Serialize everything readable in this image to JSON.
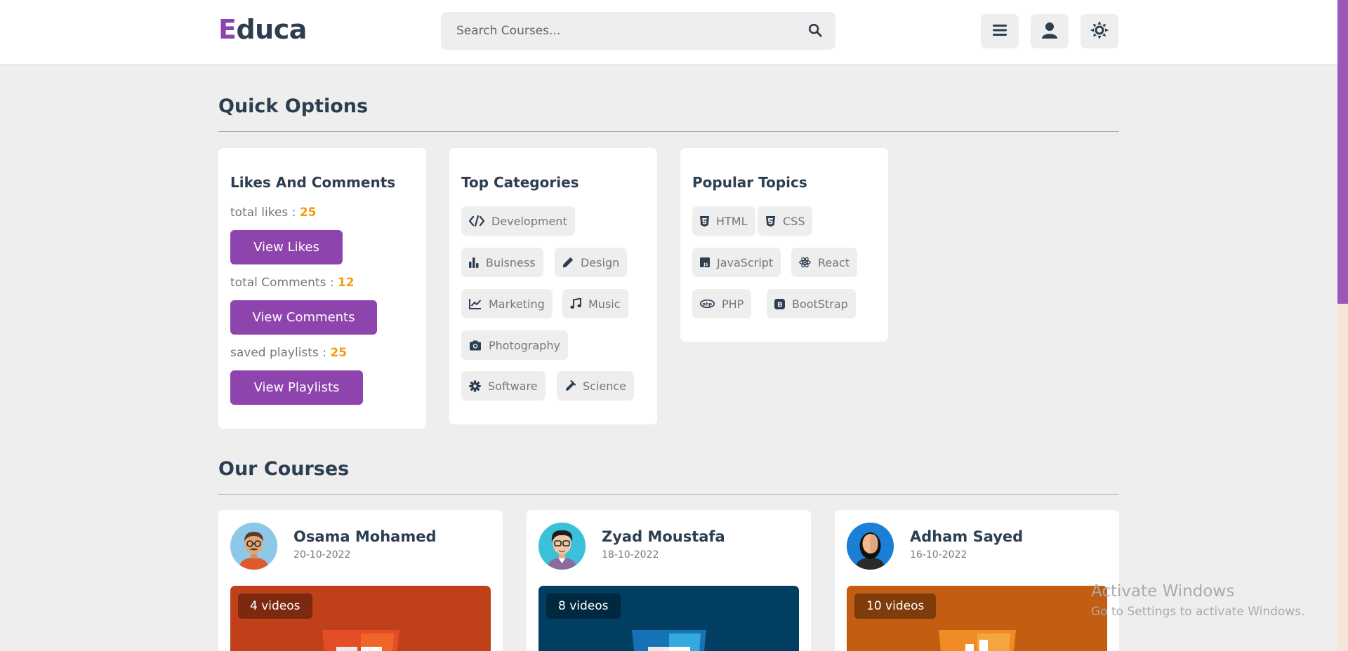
{
  "header": {
    "logo_first": "E",
    "logo_rest": "duca",
    "search_placeholder": "Search Courses..."
  },
  "quick_options": {
    "title": "Quick Options",
    "likes_box": {
      "title": "Likes And Comments",
      "likes_label": "total likes :",
      "likes_count": "25",
      "likes_button": "View Likes",
      "comments_label": "total Comments :",
      "comments_count": "12",
      "comments_button": "View Comments",
      "playlists_label": "saved playlists :",
      "playlists_count": "25",
      "playlists_button": "View Playlists"
    },
    "categories_box": {
      "title": "Top Categories",
      "items": [
        {
          "label": "Development",
          "icon": "code-icon"
        },
        {
          "label": "Buisness",
          "icon": "chart-bar-icon"
        },
        {
          "label": "Design",
          "icon": "pen-icon"
        },
        {
          "label": "Marketing",
          "icon": "chart-line-icon"
        },
        {
          "label": "Music",
          "icon": "music-icon"
        },
        {
          "label": "Photography",
          "icon": "camera-icon"
        },
        {
          "label": "Software",
          "icon": "gear-icon"
        },
        {
          "label": "Science",
          "icon": "vial-icon"
        }
      ]
    },
    "topics_box": {
      "title": "Popular Topics",
      "items": [
        {
          "label": "HTML",
          "icon": "html5-icon"
        },
        {
          "label": "CSS",
          "icon": "css3-icon"
        },
        {
          "label": "JavaScript",
          "icon": "js-icon"
        },
        {
          "label": "React",
          "icon": "react-icon"
        },
        {
          "label": "PHP",
          "icon": "php-icon"
        },
        {
          "label": "BootStrap",
          "icon": "bootstrap-icon"
        }
      ]
    }
  },
  "courses": {
    "title": "Our Courses",
    "items": [
      {
        "tutor": "Osama Mohamed",
        "date": "20-10-2022",
        "videos": "4 videos",
        "thumb_color": "#c0401a",
        "badge_color": "#e44d26"
      },
      {
        "tutor": "Zyad Moustafa",
        "date": "18-10-2022",
        "videos": "8 videos",
        "thumb_color": "#013e61",
        "badge_color": "#1572b6"
      },
      {
        "tutor": "Adham Sayed",
        "date": "16-10-2022",
        "videos": "10 videos",
        "thumb_color": "#c25d12",
        "badge_color": "#f08a24"
      }
    ]
  },
  "watermark": {
    "line1": "Activate Windows",
    "line2": "Go to Settings to activate Windows."
  },
  "colors": {
    "accent": "#8e44ad",
    "count": "#f39c12",
    "text": "#2c3e50",
    "background": "#eeeeee"
  }
}
